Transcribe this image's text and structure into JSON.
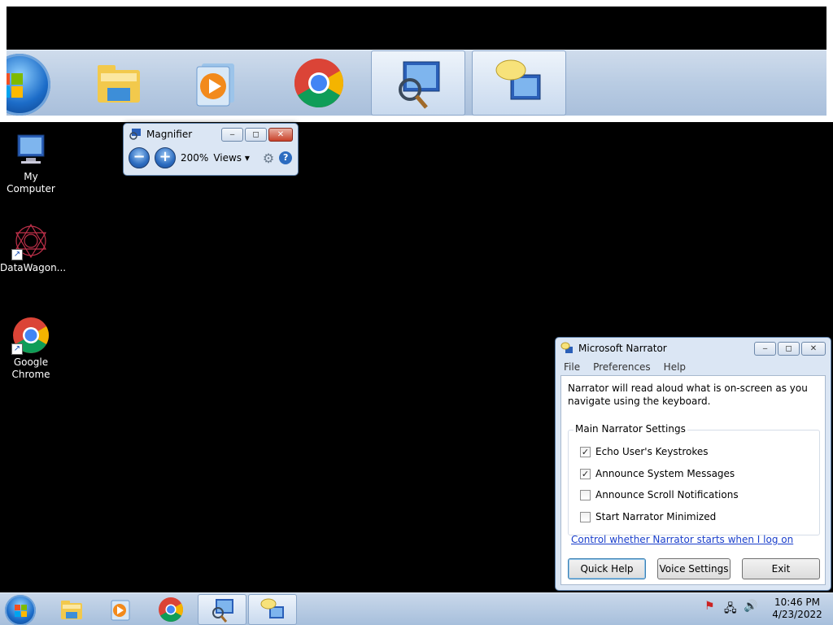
{
  "desktop": {
    "icons": [
      {
        "label": "My Computer"
      },
      {
        "label": "DataWagon..."
      },
      {
        "label": "Google Chrome"
      }
    ]
  },
  "magnifier": {
    "title": "Magnifier",
    "zoom": "200%",
    "views_label": "Views",
    "minus_label": "−",
    "plus_label": "+",
    "minimize_label": "‒",
    "restore_label": "◻",
    "close_label": "✕"
  },
  "narrator": {
    "title": "Microsoft Narrator",
    "menu": [
      "File",
      "Preferences",
      "Help"
    ],
    "description": "Narrator will read aloud what is on-screen as you navigate using the keyboard.",
    "group_label": "Main Narrator Settings",
    "options": [
      {
        "label": "Echo User's Keystrokes",
        "checked": true,
        "mark": "✓"
      },
      {
        "label": "Announce System Messages",
        "checked": true,
        "mark": "✓"
      },
      {
        "label": "Announce Scroll Notifications",
        "checked": false,
        "mark": ""
      },
      {
        "label": "Start Narrator Minimized",
        "checked": false,
        "mark": ""
      }
    ],
    "link": "Control whether Narrator starts when I log on",
    "buttons": {
      "quick_help": "Quick Help",
      "voice_settings": "Voice Settings",
      "exit": "Exit"
    },
    "minimize_label": "‒",
    "restore_label": "◻",
    "close_label": "✕"
  },
  "taskbar": {
    "items": [
      "windows-explorer",
      "media-player",
      "google-chrome",
      "magnifier",
      "narrator"
    ],
    "active": "magnifier",
    "time": "10:46 PM",
    "date": "4/23/2022"
  },
  "colors": {
    "desktop": "#000000",
    "taskbar": "#b9cce3",
    "link": "#1a3fcc"
  }
}
